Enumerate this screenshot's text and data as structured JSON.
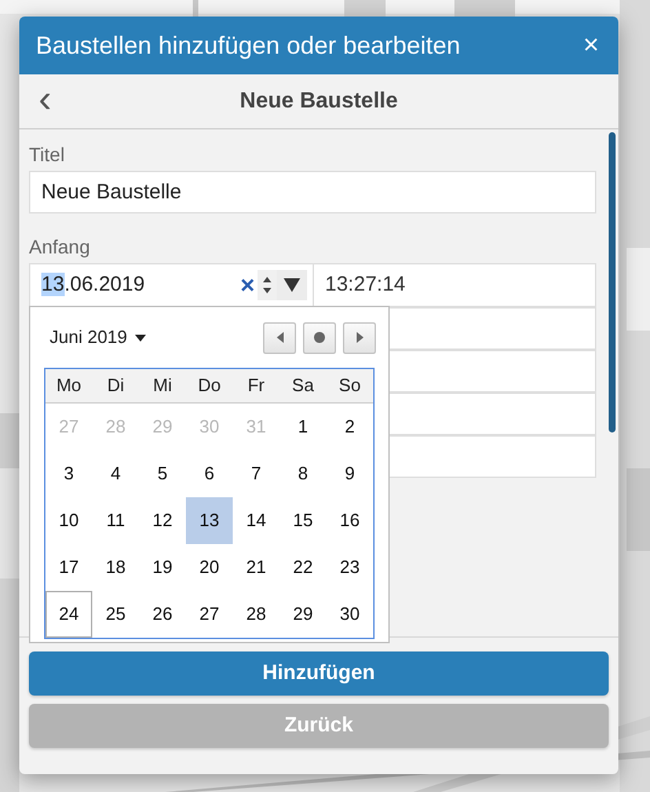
{
  "window": {
    "title": "Baustellen hinzufügen oder bearbeiten",
    "close": "×"
  },
  "subheader": {
    "back": "‹",
    "title": "Neue Baustelle"
  },
  "fields": [
    {
      "label": "Titel",
      "value": "Neue Baustelle"
    }
  ],
  "start": {
    "label": "Anfang",
    "date_parts": [
      {
        "text": "13",
        "selected": true
      },
      {
        "text": ".06.2019",
        "selected": false
      }
    ],
    "clear": "×",
    "time": "13:27:14"
  },
  "calendar": {
    "month": "Juni 2019",
    "weekdays": [
      "Mo",
      "Di",
      "Mi",
      "Do",
      "Fr",
      "Sa",
      "So"
    ],
    "days": [
      {
        "text": "27",
        "outside": true,
        "selected": false,
        "focused": false
      },
      {
        "text": "28",
        "outside": true,
        "selected": false,
        "focused": false
      },
      {
        "text": "29",
        "outside": true,
        "selected": false,
        "focused": false
      },
      {
        "text": "30",
        "outside": true,
        "selected": false,
        "focused": false
      },
      {
        "text": "31",
        "outside": true,
        "selected": false,
        "focused": false
      },
      {
        "text": "1",
        "outside": false,
        "selected": false,
        "focused": false
      },
      {
        "text": "2",
        "outside": false,
        "selected": false,
        "focused": false
      },
      {
        "text": "3",
        "outside": false,
        "selected": false,
        "focused": false
      },
      {
        "text": "4",
        "outside": false,
        "selected": false,
        "focused": false
      },
      {
        "text": "5",
        "outside": false,
        "selected": false,
        "focused": false
      },
      {
        "text": "6",
        "outside": false,
        "selected": false,
        "focused": false
      },
      {
        "text": "7",
        "outside": false,
        "selected": false,
        "focused": false
      },
      {
        "text": "8",
        "outside": false,
        "selected": false,
        "focused": false
      },
      {
        "text": "9",
        "outside": false,
        "selected": false,
        "focused": false
      },
      {
        "text": "10",
        "outside": false,
        "selected": false,
        "focused": false
      },
      {
        "text": "11",
        "outside": false,
        "selected": false,
        "focused": false
      },
      {
        "text": "12",
        "outside": false,
        "selected": false,
        "focused": false
      },
      {
        "text": "13",
        "outside": false,
        "selected": true,
        "focused": false
      },
      {
        "text": "14",
        "outside": false,
        "selected": false,
        "focused": false
      },
      {
        "text": "15",
        "outside": false,
        "selected": false,
        "focused": false
      },
      {
        "text": "16",
        "outside": false,
        "selected": false,
        "focused": false
      },
      {
        "text": "17",
        "outside": false,
        "selected": false,
        "focused": false
      },
      {
        "text": "18",
        "outside": false,
        "selected": false,
        "focused": false
      },
      {
        "text": "19",
        "outside": false,
        "selected": false,
        "focused": false
      },
      {
        "text": "20",
        "outside": false,
        "selected": false,
        "focused": false
      },
      {
        "text": "21",
        "outside": false,
        "selected": false,
        "focused": false
      },
      {
        "text": "22",
        "outside": false,
        "selected": false,
        "focused": false
      },
      {
        "text": "23",
        "outside": false,
        "selected": false,
        "focused": false
      },
      {
        "text": "24",
        "outside": false,
        "selected": false,
        "focused": true
      },
      {
        "text": "25",
        "outside": false,
        "selected": false,
        "focused": false
      },
      {
        "text": "26",
        "outside": false,
        "selected": false,
        "focused": false
      },
      {
        "text": "27",
        "outside": false,
        "selected": false,
        "focused": false
      },
      {
        "text": "28",
        "outside": false,
        "selected": false,
        "focused": false
      },
      {
        "text": "29",
        "outside": false,
        "selected": false,
        "focused": false
      },
      {
        "text": "30",
        "outside": false,
        "selected": false,
        "focused": false
      }
    ]
  },
  "buttons": [
    {
      "label": "Hinzufügen",
      "kind": "primary"
    },
    {
      "label": "Zurück",
      "kind": "secondary"
    }
  ]
}
